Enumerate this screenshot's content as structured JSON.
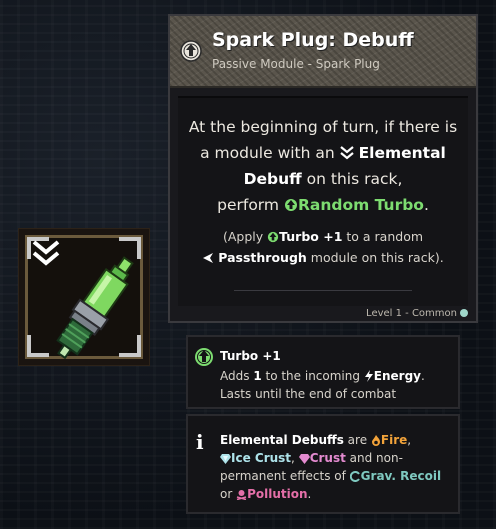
{
  "card": {
    "title": "Spark Plug: Debuff",
    "subtitle": "Passive Module - Spark Plug",
    "desc_1": "At the beginning of turn, if there is",
    "desc_2a": "a module with an ",
    "desc_2b": "Elemental",
    "desc_3a": "Debuff",
    "desc_3b": " on this rack,",
    "desc_4a": "perform ",
    "desc_4b": "Random Turbo",
    "desc_4c": ".",
    "note_1a": "(Apply ",
    "note_1b": "Turbo +1",
    "note_1c": " to a random",
    "note_2a": "Passthrough",
    "note_2b": " module on this rack).",
    "footer": "Level 1 - Common"
  },
  "keyword_turbo": {
    "title": "Turbo +1",
    "line1a": "Adds ",
    "line1b": "1",
    "line1c": " to the incoming ",
    "line1d": "Energy",
    "line1e": ".",
    "line2": "Lasts until the end of combat"
  },
  "keyword_elemental": {
    "t1": "Elemental Debuffs",
    "t2": " are ",
    "fire": "Fire",
    "t3": ",",
    "ice": "Ice Crust",
    "t4": ", ",
    "crust": "Crust",
    "t5": " and non-",
    "t6": "permanent effects of ",
    "grav": "Grav. Recoil",
    "t7": "or ",
    "pollution": "Pollution",
    "t8": "."
  },
  "colors": {
    "green": "#7ddc70",
    "fire": "#f2a33a",
    "ice": "#aee3ea",
    "crust": "#e48bd0",
    "grav": "#7fc9c0",
    "pollution": "#e46fa8",
    "rarity_common": "#9fd6c9"
  },
  "icons": {
    "item": "spark-plug-icon",
    "debuff": "double-chevron-down-icon",
    "turbo": "turbo-arrow-up-icon",
    "info": "info-icon"
  }
}
